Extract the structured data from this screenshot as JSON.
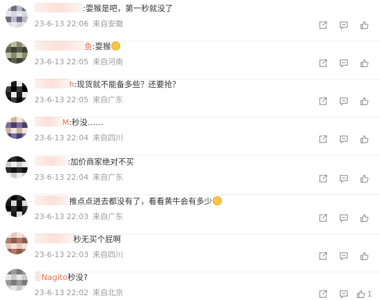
{
  "comments": [
    {
      "name_visible": "",
      "text": ":耍猴是吧，第一秒就没了",
      "time": "23-6-13 22:06",
      "source": "来自安徽",
      "emoji": false
    },
    {
      "name_visible": "鱼",
      "text": ":耍猴",
      "time": "23-6-13 22:05",
      "source": "来自河南",
      "emoji": true
    },
    {
      "name_visible": "h",
      "text": ":现货就不能备多些？还要抢？",
      "time": "23-6-13 22:05",
      "source": "来自广东",
      "emoji": false
    },
    {
      "name_visible": "M",
      "text": ":秒没……",
      "time": "23-6-13 22:04",
      "source": "来自四川",
      "emoji": false
    },
    {
      "name_visible": "",
      "text": ":加价商家绝对不买",
      "time": "23-6-13 22:04",
      "source": "来自广东",
      "emoji": false
    },
    {
      "name_visible": "",
      "text": "推点点进去都没有了，看看黄牛会有多少",
      "time": "23-6-13 22:03",
      "source": "来自广东",
      "emoji": true
    },
    {
      "name_visible": "",
      "text": "秒无买个屁啊",
      "time": "23-6-13 22:03",
      "source": "来自四川",
      "emoji": false
    },
    {
      "name_visible": "Nagito",
      "text": "秒没?",
      "time": "23-6-13 22:02",
      "source": "来自北京",
      "emoji": false,
      "likes": "1"
    }
  ],
  "icons": [
    "share-icon",
    "comment-icon",
    "like-icon"
  ],
  "colors": {
    "username": "#eb7350",
    "meta": "#999999",
    "icon": "#8f8f8f"
  }
}
